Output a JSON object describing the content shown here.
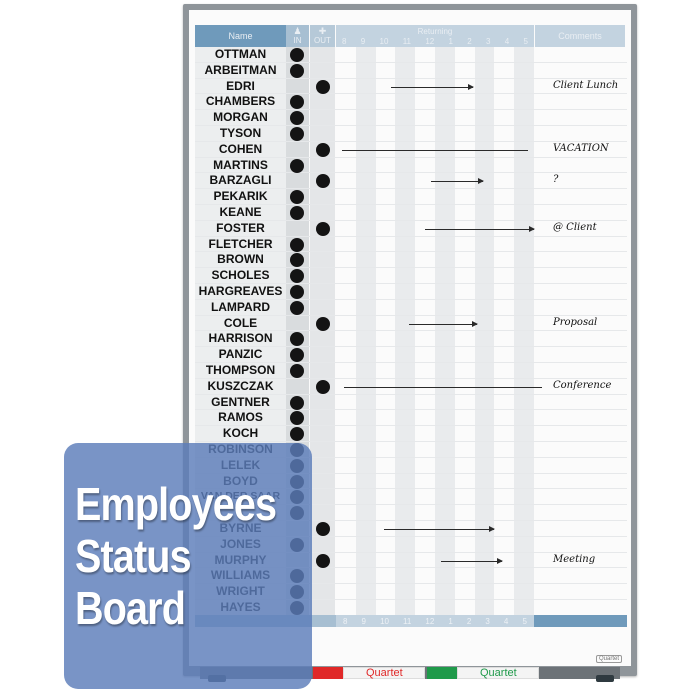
{
  "board": {
    "headers": {
      "name": "Name",
      "in_icon": "person-at-desk-icon",
      "in": "IN",
      "out_icon": "walking-person-icon",
      "out": "OUT",
      "returning": "Returning",
      "comments": "Comments",
      "time_ticks": [
        "8",
        "9",
        "10",
        "11",
        "12",
        "1",
        "2",
        "3",
        "4",
        "5"
      ]
    },
    "employees": [
      {
        "name": "OTTMAN",
        "status": "in"
      },
      {
        "name": "ARBEITMAN",
        "status": "in"
      },
      {
        "name": "EDRI",
        "status": "out",
        "comment": "Client Lunch"
      },
      {
        "name": "CHAMBERS",
        "status": "in"
      },
      {
        "name": "MORGAN",
        "status": "in"
      },
      {
        "name": "TYSON",
        "status": "in"
      },
      {
        "name": "COHEN",
        "status": "out",
        "comment": "VACATION"
      },
      {
        "name": "MARTINS",
        "status": "in"
      },
      {
        "name": "BARZAGLI",
        "status": "out",
        "comment": "?"
      },
      {
        "name": "PEKARIK",
        "status": "in"
      },
      {
        "name": "KEANE",
        "status": "in"
      },
      {
        "name": "FOSTER",
        "status": "out",
        "comment": "@ Client"
      },
      {
        "name": "FLETCHER",
        "status": "in"
      },
      {
        "name": "BROWN",
        "status": "in"
      },
      {
        "name": "SCHOLES",
        "status": "in"
      },
      {
        "name": "HARGREAVES",
        "status": "in"
      },
      {
        "name": "LAMPARD",
        "status": "in"
      },
      {
        "name": "COLE",
        "status": "out",
        "comment": "Proposal"
      },
      {
        "name": "HARRISON",
        "status": "in"
      },
      {
        "name": "PANZIC",
        "status": "in"
      },
      {
        "name": "THOMPSON",
        "status": "in"
      },
      {
        "name": "KUSZCZAK",
        "status": "out",
        "comment": "Conference"
      },
      {
        "name": "GENTNER",
        "status": "in"
      },
      {
        "name": "RAMOS",
        "status": "in"
      },
      {
        "name": "KOCH",
        "status": "in"
      },
      {
        "name": "ROBINSON",
        "status": "in"
      },
      {
        "name": "LELEK",
        "status": "in"
      },
      {
        "name": "BOYD",
        "status": "in"
      },
      {
        "name": "VAN DER SAAR",
        "status": "in"
      },
      {
        "name": "",
        "status": "in"
      },
      {
        "name": "BYRNE",
        "status": "out"
      },
      {
        "name": "JONES",
        "status": "in"
      },
      {
        "name": "MURPHY",
        "status": "out",
        "comment": "Meeting"
      },
      {
        "name": "WILLIAMS",
        "status": "in"
      },
      {
        "name": "WRIGHT",
        "status": "in"
      },
      {
        "name": "HAYES",
        "status": "in"
      }
    ],
    "brand": "Quartet"
  },
  "markers": [
    {
      "label": "Quartet",
      "color": "#e02828"
    },
    {
      "label": "Quartet",
      "color": "#1f9a4a"
    }
  ],
  "overlay": {
    "line1": "Employees",
    "line2": "Status",
    "line3": "Board"
  }
}
